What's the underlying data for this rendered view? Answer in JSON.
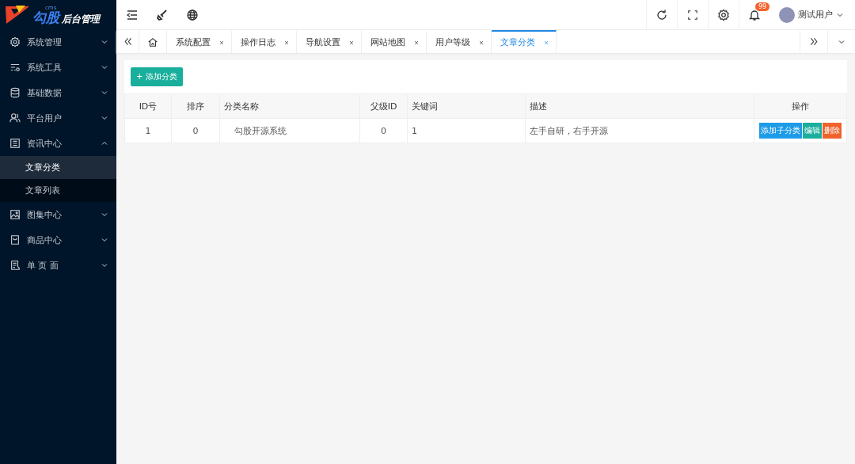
{
  "logo": {
    "small": "cms",
    "brand": "勾股",
    "suffix": "后台管理"
  },
  "sidebar": {
    "items": [
      {
        "label": "系统管理",
        "expanded": false
      },
      {
        "label": "系统工具",
        "expanded": false
      },
      {
        "label": "基础数据",
        "expanded": false
      },
      {
        "label": "平台用户",
        "expanded": false
      },
      {
        "label": "资讯中心",
        "expanded": true,
        "children": [
          {
            "label": "文章分类",
            "selected": true
          },
          {
            "label": "文章列表",
            "selected": false
          }
        ]
      },
      {
        "label": "图集中心",
        "expanded": false
      },
      {
        "label": "商品中心",
        "expanded": false
      },
      {
        "label": "单 页 面",
        "expanded": false
      }
    ]
  },
  "header": {
    "notification_count": "99",
    "user": "测试用户"
  },
  "tabs": [
    {
      "label": "系统配置",
      "selected": false
    },
    {
      "label": "操作日志",
      "selected": false
    },
    {
      "label": "导航设置",
      "selected": false
    },
    {
      "label": "网站地图",
      "selected": false
    },
    {
      "label": "用户等级",
      "selected": false
    },
    {
      "label": "文章分类",
      "selected": true
    }
  ],
  "add_button": "+ 添加分类",
  "table": {
    "columns": [
      "ID号",
      "排序",
      "分类名称",
      "父级ID",
      "关键词",
      "描述",
      "操作"
    ],
    "rows": [
      {
        "cells": [
          "1",
          "0",
          "勾股开源系统",
          "0",
          "1",
          "左手自研，右手开源"
        ],
        "actions": [
          {
            "kind": "add",
            "label": "添加子分类"
          },
          {
            "kind": "edit",
            "label": "编辑"
          },
          {
            "kind": "delete",
            "label": "删除"
          }
        ]
      }
    ]
  }
}
